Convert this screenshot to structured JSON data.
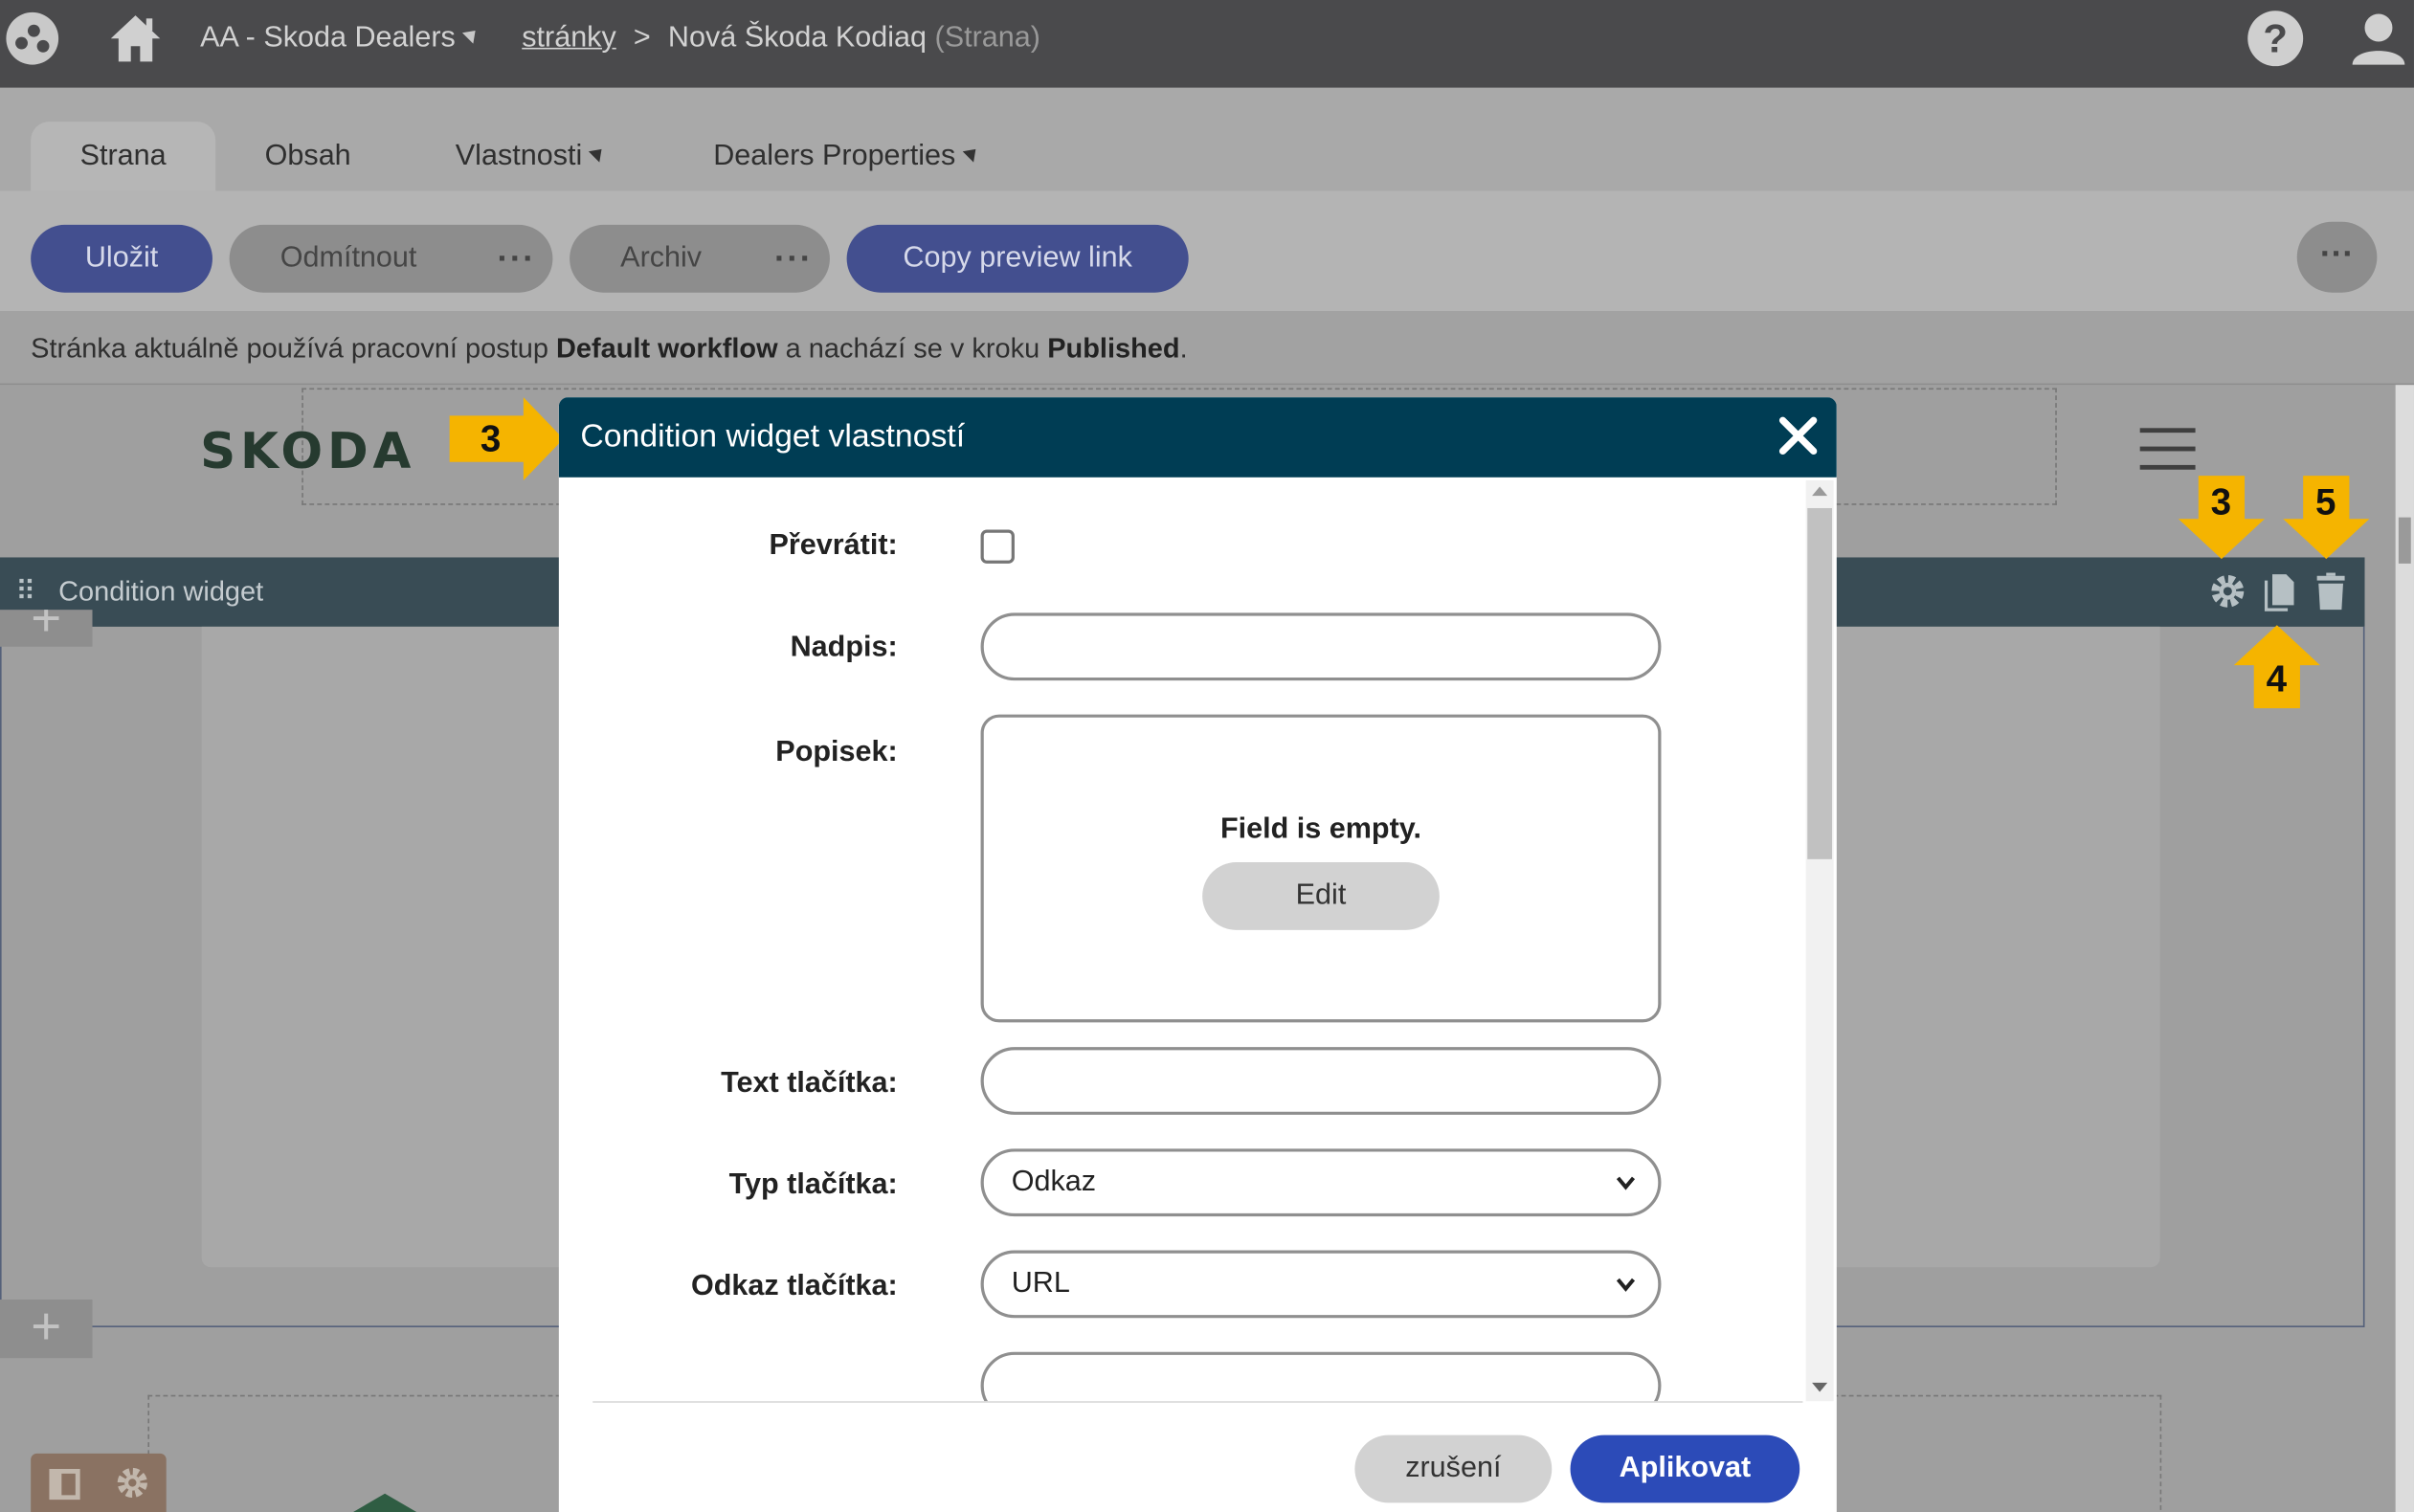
{
  "topbar": {
    "site_name": "AA - Skoda Dealers",
    "breadcrumb_link": "stránky",
    "breadcrumb_separator": ">",
    "page_name": "Nová Škoda Kodiaq",
    "page_type": "(Strana)",
    "icons": [
      "app-logo-icon",
      "home-icon",
      "help-icon",
      "user-icon"
    ]
  },
  "tabs": [
    {
      "label": "Strana",
      "active": true
    },
    {
      "label": "Obsah",
      "active": false
    },
    {
      "label": "Vlastnosti",
      "active": false
    },
    {
      "label": "Dealers Properties",
      "active": false
    }
  ],
  "toolbar": {
    "save": "Uložit",
    "reject": "Odmítnout",
    "archive": "Archiv",
    "copy_preview": "Copy preview link",
    "dots": "···"
  },
  "workflow": {
    "prefix": "Stránka aktuálně používá pracovní postup ",
    "workflow_name": "Default workflow",
    "middle": " a nachází se v kroku ",
    "step": "Published",
    "suffix": "."
  },
  "canvas": {
    "brand_logo": "SKODA",
    "widget_label": "Condition widget",
    "widget_actions": [
      "gear-icon",
      "copy-icon",
      "trash-icon"
    ],
    "add_symbol": "+"
  },
  "callouts": {
    "c3_title": "3",
    "c3_gear": "3",
    "c4_copy": "4",
    "c5_delete": "5",
    "color": "#f5b400"
  },
  "dialog": {
    "title": "Condition widget vlastností",
    "fields": {
      "invert_label": "Převrátit:",
      "invert_checked": false,
      "heading_label": "Nadpis:",
      "heading_value": "",
      "caption_label": "Popisek:",
      "caption_empty_text": "Field is empty.",
      "caption_edit_button": "Edit",
      "button_text_label": "Text tlačítka:",
      "button_text_value": "",
      "button_type_label": "Typ tlačítka:",
      "button_type_value": "Odkaz",
      "button_link_label": "Odkaz tlačítka:",
      "button_link_value": "URL"
    },
    "cancel": "zrušení",
    "apply": "Aplikovat"
  },
  "colors": {
    "header_bg": "#4a4a4c",
    "dialog_header": "#003d54",
    "primary_button": "#2c4bb8",
    "widget_bar": "#394c55"
  }
}
